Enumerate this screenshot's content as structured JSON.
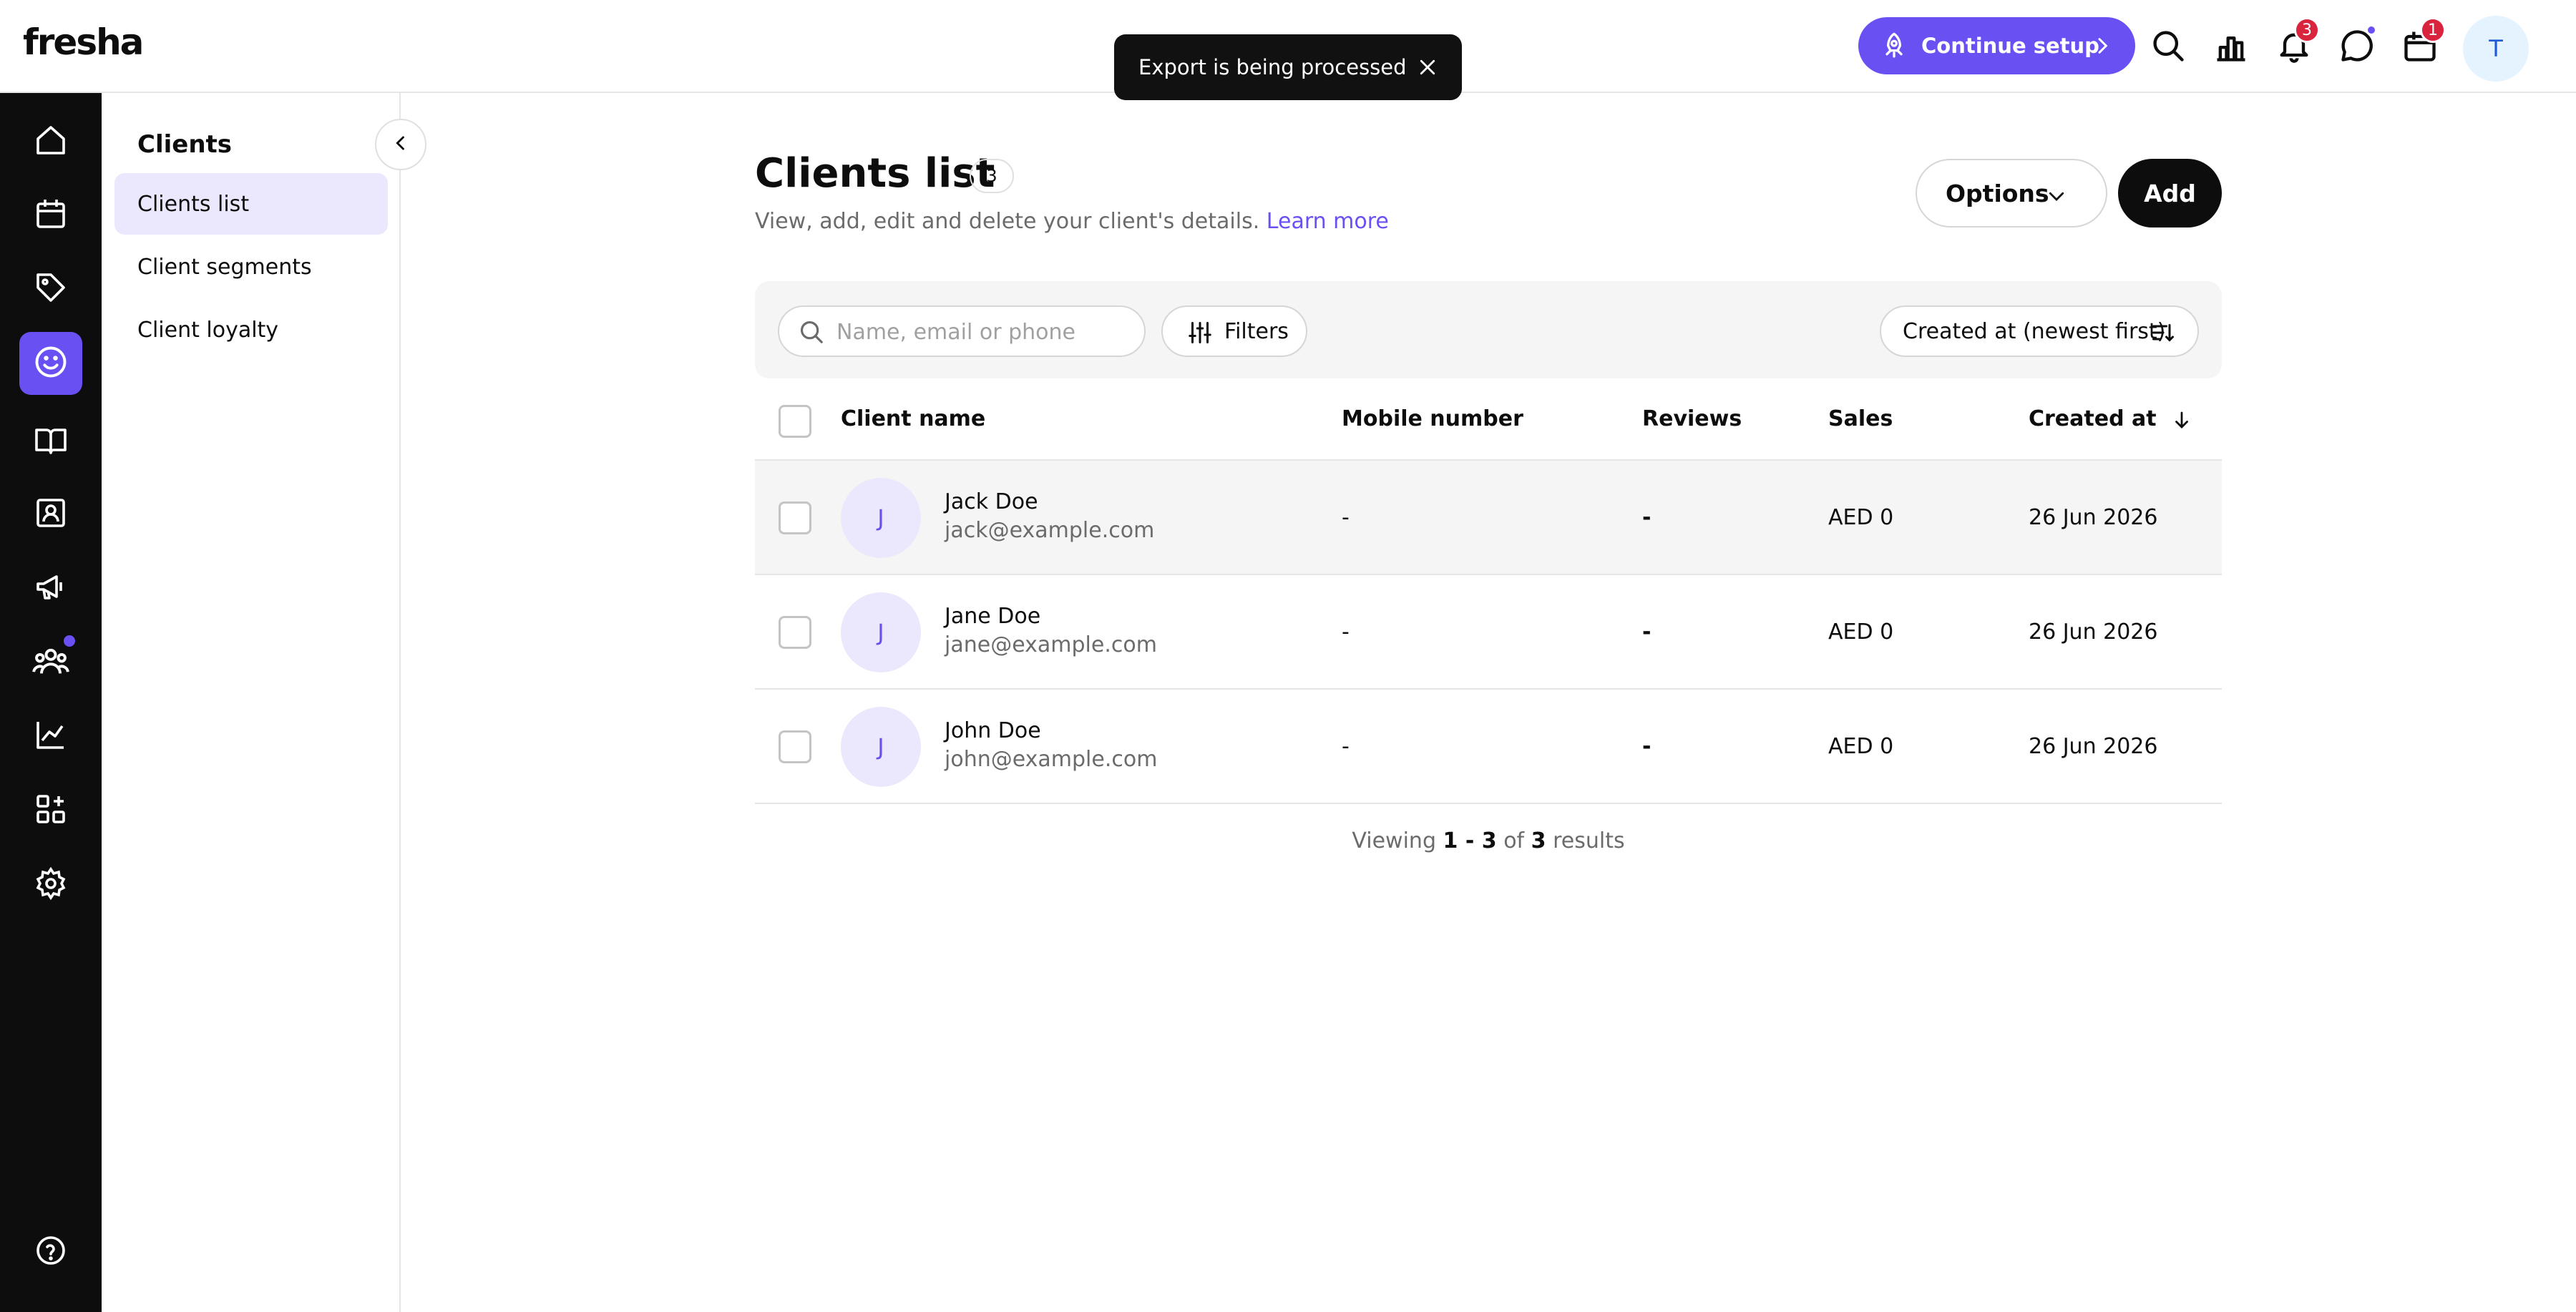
{
  "brand": {
    "logo_text": "fresha",
    "accent_color": "#6950f3"
  },
  "toast": {
    "message": "Export is being processed",
    "close_icon": "close-icon"
  },
  "topbar": {
    "setup_label": "Continue setup",
    "notifications_badge": "3",
    "calendar_badge": "1",
    "user_initial": "T"
  },
  "rail": {
    "items": [
      {
        "name": "home",
        "icon": "home-icon"
      },
      {
        "name": "calendar",
        "icon": "calendar-icon"
      },
      {
        "name": "sales",
        "icon": "tag-icon"
      },
      {
        "name": "clients",
        "icon": "smiley-icon",
        "active": true
      },
      {
        "name": "catalog",
        "icon": "book-icon"
      },
      {
        "name": "team",
        "icon": "contact-card-icon"
      },
      {
        "name": "marketing",
        "icon": "megaphone-icon"
      },
      {
        "name": "team-members",
        "icon": "people-icon"
      },
      {
        "name": "reports",
        "icon": "chart-icon"
      },
      {
        "name": "add-ons",
        "icon": "apps-icon"
      },
      {
        "name": "settings",
        "icon": "gear-icon"
      },
      {
        "name": "help",
        "icon": "help-icon"
      }
    ]
  },
  "subnav": {
    "title": "Clients",
    "items": [
      {
        "label": "Clients list",
        "active": true
      },
      {
        "label": "Client segments"
      },
      {
        "label": "Client loyalty"
      }
    ]
  },
  "page": {
    "title": "Clients list",
    "count": "3",
    "subtitle": "View, add, edit and delete your client's details.",
    "learn_more": "Learn more",
    "options_label": "Options",
    "add_label": "Add"
  },
  "toolbar": {
    "search_placeholder": "Name, email or phone",
    "filters_label": "Filters",
    "sort_label": "Created at (newest first)"
  },
  "table": {
    "columns": [
      "Client name",
      "Mobile number",
      "Reviews",
      "Sales",
      "Created at"
    ],
    "rows": [
      {
        "initial": "J",
        "name": "Jack Doe",
        "email": "jack@example.com",
        "mobile": "-",
        "reviews": "-",
        "sales": "AED 0",
        "created": "26 Jun 2026"
      },
      {
        "initial": "J",
        "name": "Jane Doe",
        "email": "jane@example.com",
        "mobile": "-",
        "reviews": "-",
        "sales": "AED 0",
        "created": "26 Jun 2026"
      },
      {
        "initial": "J",
        "name": "John Doe",
        "email": "john@example.com",
        "mobile": "-",
        "reviews": "-",
        "sales": "AED 0",
        "created": "26 Jun 2026"
      }
    ]
  },
  "pagination": {
    "prefix": "Viewing",
    "range": "1 - 3",
    "of": "of",
    "total": "3",
    "suffix": "results"
  }
}
